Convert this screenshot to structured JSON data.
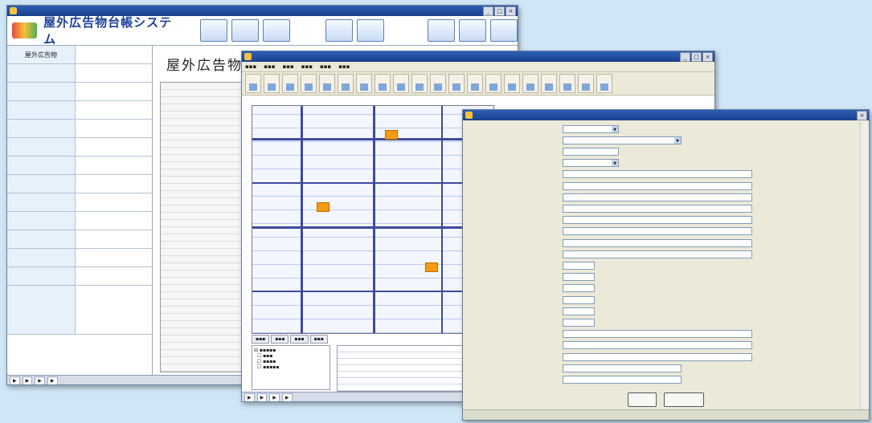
{
  "window_main": {
    "title": "",
    "app_title": "屋外広告物台帳システム",
    "page_heading": "屋外広告物",
    "fields": [
      {
        "label": "屋外広告物",
        "value": ""
      },
      {
        "label": "",
        "value": ""
      },
      {
        "label": "",
        "value": ""
      },
      {
        "label": "",
        "value": ""
      },
      {
        "label": "",
        "value": ""
      },
      {
        "label": "",
        "value": ""
      },
      {
        "label": "",
        "value": ""
      },
      {
        "label": "",
        "value": ""
      },
      {
        "label": "",
        "value": ""
      },
      {
        "label": "",
        "value": ""
      },
      {
        "label": "",
        "value": ""
      },
      {
        "label": "",
        "value": ""
      },
      {
        "label": "",
        "value": ""
      },
      {
        "label": "",
        "value": ""
      }
    ]
  },
  "window_map": {
    "title": ""
  },
  "window_form": {
    "title": "",
    "fields": [
      {
        "label": "",
        "value": "",
        "width": "s",
        "select": true
      },
      {
        "label": "",
        "value": "",
        "width": "m",
        "select": true
      },
      {
        "label": "",
        "value": "",
        "width": "s",
        "select": false
      },
      {
        "label": "",
        "value": "",
        "width": "s",
        "select": true
      },
      {
        "label": "",
        "value": "",
        "width": "l",
        "select": false
      },
      {
        "label": "",
        "value": "",
        "width": "l",
        "select": false
      },
      {
        "label": "",
        "value": "",
        "width": "l",
        "select": false
      },
      {
        "label": "",
        "value": "",
        "width": "l",
        "select": false
      },
      {
        "label": "",
        "value": "",
        "width": "l",
        "select": false
      },
      {
        "label": "",
        "value": "",
        "width": "l",
        "select": false
      },
      {
        "label": "",
        "value": "",
        "width": "l",
        "select": false
      },
      {
        "label": "",
        "value": "",
        "width": "l",
        "select": false
      },
      {
        "label": "",
        "value": "",
        "width": "xs",
        "select": false
      },
      {
        "label": "",
        "value": "",
        "width": "xs",
        "select": false
      },
      {
        "label": "",
        "value": "",
        "width": "xs",
        "select": false
      },
      {
        "label": "",
        "value": "",
        "width": "xs",
        "select": false
      },
      {
        "label": "",
        "value": "",
        "width": "xs",
        "select": false
      },
      {
        "label": "",
        "value": "",
        "width": "xs",
        "select": false
      },
      {
        "label": "",
        "value": "",
        "width": "l",
        "select": false
      },
      {
        "label": "",
        "value": "",
        "width": "l",
        "select": false
      },
      {
        "label": "",
        "value": "",
        "width": "l",
        "select": false
      },
      {
        "label": "",
        "value": "",
        "width": "m",
        "select": false
      },
      {
        "label": "",
        "value": "",
        "width": "m",
        "select": false
      }
    ],
    "ok_label": "",
    "cancel_label": "",
    "status": ""
  }
}
